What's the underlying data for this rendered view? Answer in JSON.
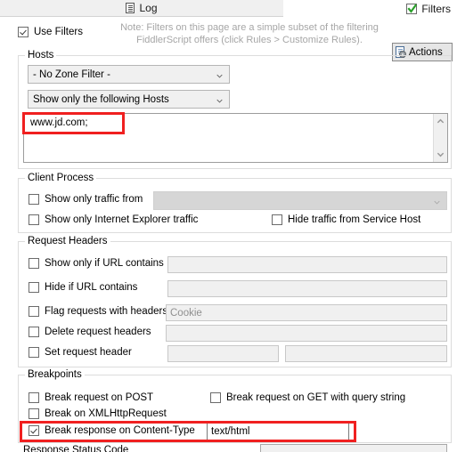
{
  "tabs": {
    "log": {
      "label": "Log",
      "icon": "log-document-icon"
    },
    "filters": {
      "label": "Filters",
      "icon": "green-check-icon",
      "checked": true
    }
  },
  "header": {
    "use_filters_label": "Use Filters",
    "use_filters_checked": true,
    "note_line1": "Note: Filters on this page are a simple subset of the filtering",
    "note_line2": "FiddlerScript offers (click Rules > Customize Rules).",
    "actions_label": "Actions",
    "actions_icon": "document-gear-icon"
  },
  "hosts": {
    "title": "Hosts",
    "zone_filter_value": "- No Zone Filter -",
    "host_mode_value": "Show only the following Hosts",
    "host_list_value": "www.jd.com;",
    "scroll_up_icon": "chevron-up-icon",
    "scroll_down_icon": "chevron-down-icon"
  },
  "client_process": {
    "title": "Client Process",
    "show_only_traffic_from_label": "Show only traffic from",
    "show_only_traffic_from_checked": false,
    "process_select_value": "",
    "show_only_ie_label": "Show only Internet Explorer traffic",
    "show_only_ie_checked": false,
    "hide_service_host_label": "Hide traffic from Service Host",
    "hide_service_host_checked": false
  },
  "request_headers": {
    "title": "Request Headers",
    "rows": [
      {
        "label": "Show only if URL contains",
        "checked": false,
        "value": ""
      },
      {
        "label": "Hide if URL contains",
        "checked": false,
        "value": ""
      },
      {
        "label": "Flag requests with headers",
        "checked": false,
        "value": "Cookie"
      },
      {
        "label": "Delete request headers",
        "checked": false,
        "value": ""
      },
      {
        "label": "Set request header",
        "checked": false,
        "value": "",
        "value2": ""
      }
    ]
  },
  "breakpoints": {
    "title": "Breakpoints",
    "break_post_label": "Break request on POST",
    "break_post_checked": false,
    "break_get_label": "Break request on GET with query string",
    "break_get_checked": false,
    "break_xhr_label": "Break on XMLHttpRequest",
    "break_xhr_checked": false,
    "break_content_type_label": "Break response on Content-Type",
    "break_content_type_checked": true,
    "break_content_type_value": "text/html"
  },
  "response_status": {
    "title": "Response Status Code"
  },
  "colors": {
    "annotation_red": "#f02020",
    "green_check": "#2aa02a",
    "note_gray": "#a6a6a6"
  }
}
